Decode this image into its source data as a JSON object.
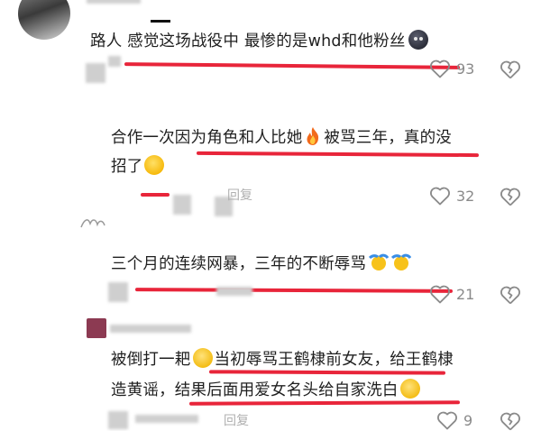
{
  "comments": [
    {
      "text": "路人 感觉这场战役中 最惨的是whd和他粉丝",
      "likes": "93"
    },
    {
      "line1": "合作一次因为角色和人比她",
      "line1_after": "被骂三年，真的没",
      "line2": "招了",
      "likes": "32"
    },
    {
      "text": "三个月的连续网暴，三年的不断辱骂",
      "likes": "21"
    },
    {
      "line1_a": "被倒打一耙",
      "line1_b": "当初辱骂王鹤棣前女友，给王鹤棣",
      "line2_a": "造黄谣，结果后面用爱女名头给自家洗白",
      "reply_label": "回复",
      "likes": "9"
    }
  ],
  "reply_label_2": "回复",
  "icons": [
    "heart-icon",
    "broken-heart-icon"
  ],
  "colors": {
    "underline": "#e8253a",
    "icon_grey": "#8a8a8a"
  }
}
